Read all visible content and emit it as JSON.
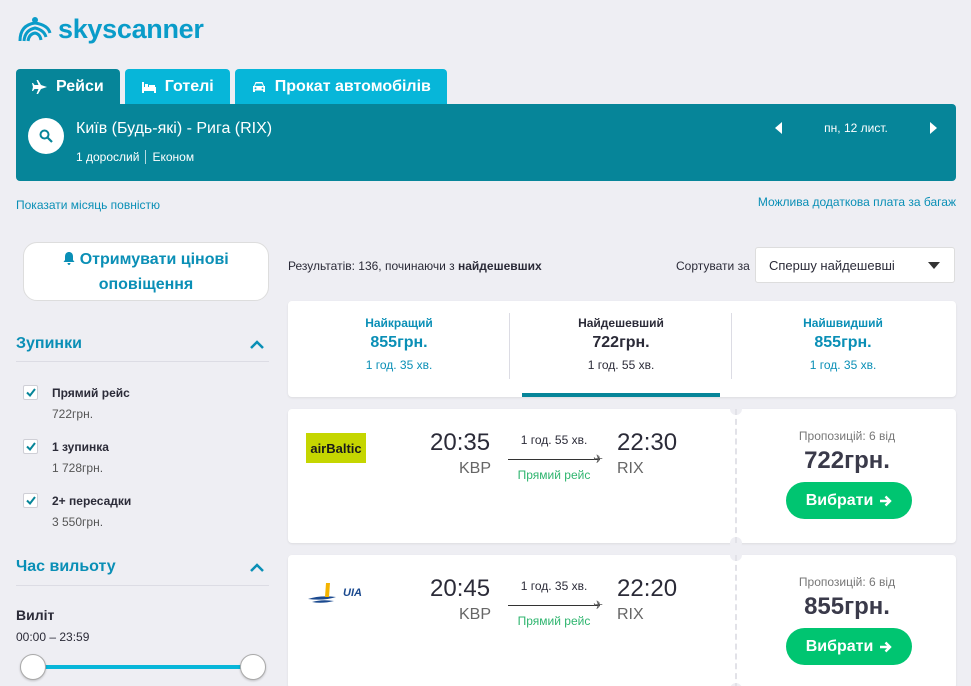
{
  "brand": {
    "name": "skyscanner"
  },
  "tabs": [
    {
      "label": "Рейси",
      "icon": "plane-icon",
      "active": true
    },
    {
      "label": "Готелі",
      "icon": "bed-icon",
      "active": false
    },
    {
      "label": "Прокат автомобілів",
      "icon": "car-icon",
      "active": false
    }
  ],
  "search": {
    "route": "Київ (Будь-які) - Рига (RIX)",
    "passengers": "1 дорослий",
    "cabin": "Економ",
    "date": "пн, 12 лист."
  },
  "links": {
    "show_month": "Показати місяць повністю",
    "baggage": "Можлива додаткова плата за багаж"
  },
  "alerts": {
    "line1": "Отримувати цінові",
    "line2": "оповіщення"
  },
  "filters": {
    "stops": {
      "title": "Зупинки",
      "options": [
        {
          "label": "Прямий рейс",
          "price": "722грн.",
          "checked": true
        },
        {
          "label": "1 зупинка",
          "price": "1 728грн.",
          "checked": true
        },
        {
          "label": "2+ пересадки",
          "price": "3 550грн.",
          "checked": true
        }
      ]
    },
    "departure_time": {
      "title": "Час вильоту",
      "label": "Виліт",
      "range": "00:00 – 23:59"
    }
  },
  "results": {
    "count_prefix": "Результатів: 136, починаючи з ",
    "count_bold": "найдешевших",
    "sort_label": "Сортувати за",
    "sort_value": "Спершу найдешевші"
  },
  "summary": [
    {
      "title": "Найкращий",
      "price": "855грн.",
      "duration": "1 год. 35 хв.",
      "selected": false
    },
    {
      "title": "Найдешевший",
      "price": "722грн.",
      "duration": "1 год. 55 хв.",
      "selected": true
    },
    {
      "title": "Найшвидший",
      "price": "855грн.",
      "duration": "1 год. 35 хв.",
      "selected": false
    }
  ],
  "flights": [
    {
      "airline": "airBaltic",
      "dep_time": "20:35",
      "dep_code": "KBP",
      "arr_time": "22:30",
      "arr_code": "RIX",
      "duration": "1 год. 55 хв.",
      "stops": "Прямий рейс",
      "offers": "Пропозицій: 6 від",
      "price": "722грн.",
      "button": "Вибрати"
    },
    {
      "airline": "UIA",
      "dep_time": "20:45",
      "dep_code": "KBP",
      "arr_time": "22:20",
      "arr_code": "RIX",
      "duration": "1 год. 35 хв.",
      "stops": "Прямий рейс",
      "offers": "Пропозицій: 6 від",
      "price": "855грн.",
      "button": "Вибрати"
    }
  ],
  "colors": {
    "teal_dark": "#068599",
    "teal_light": "#07b6d9",
    "link_blue": "#0a8fb6",
    "green": "#00c571",
    "airbaltic_bg": "#c5d600"
  }
}
